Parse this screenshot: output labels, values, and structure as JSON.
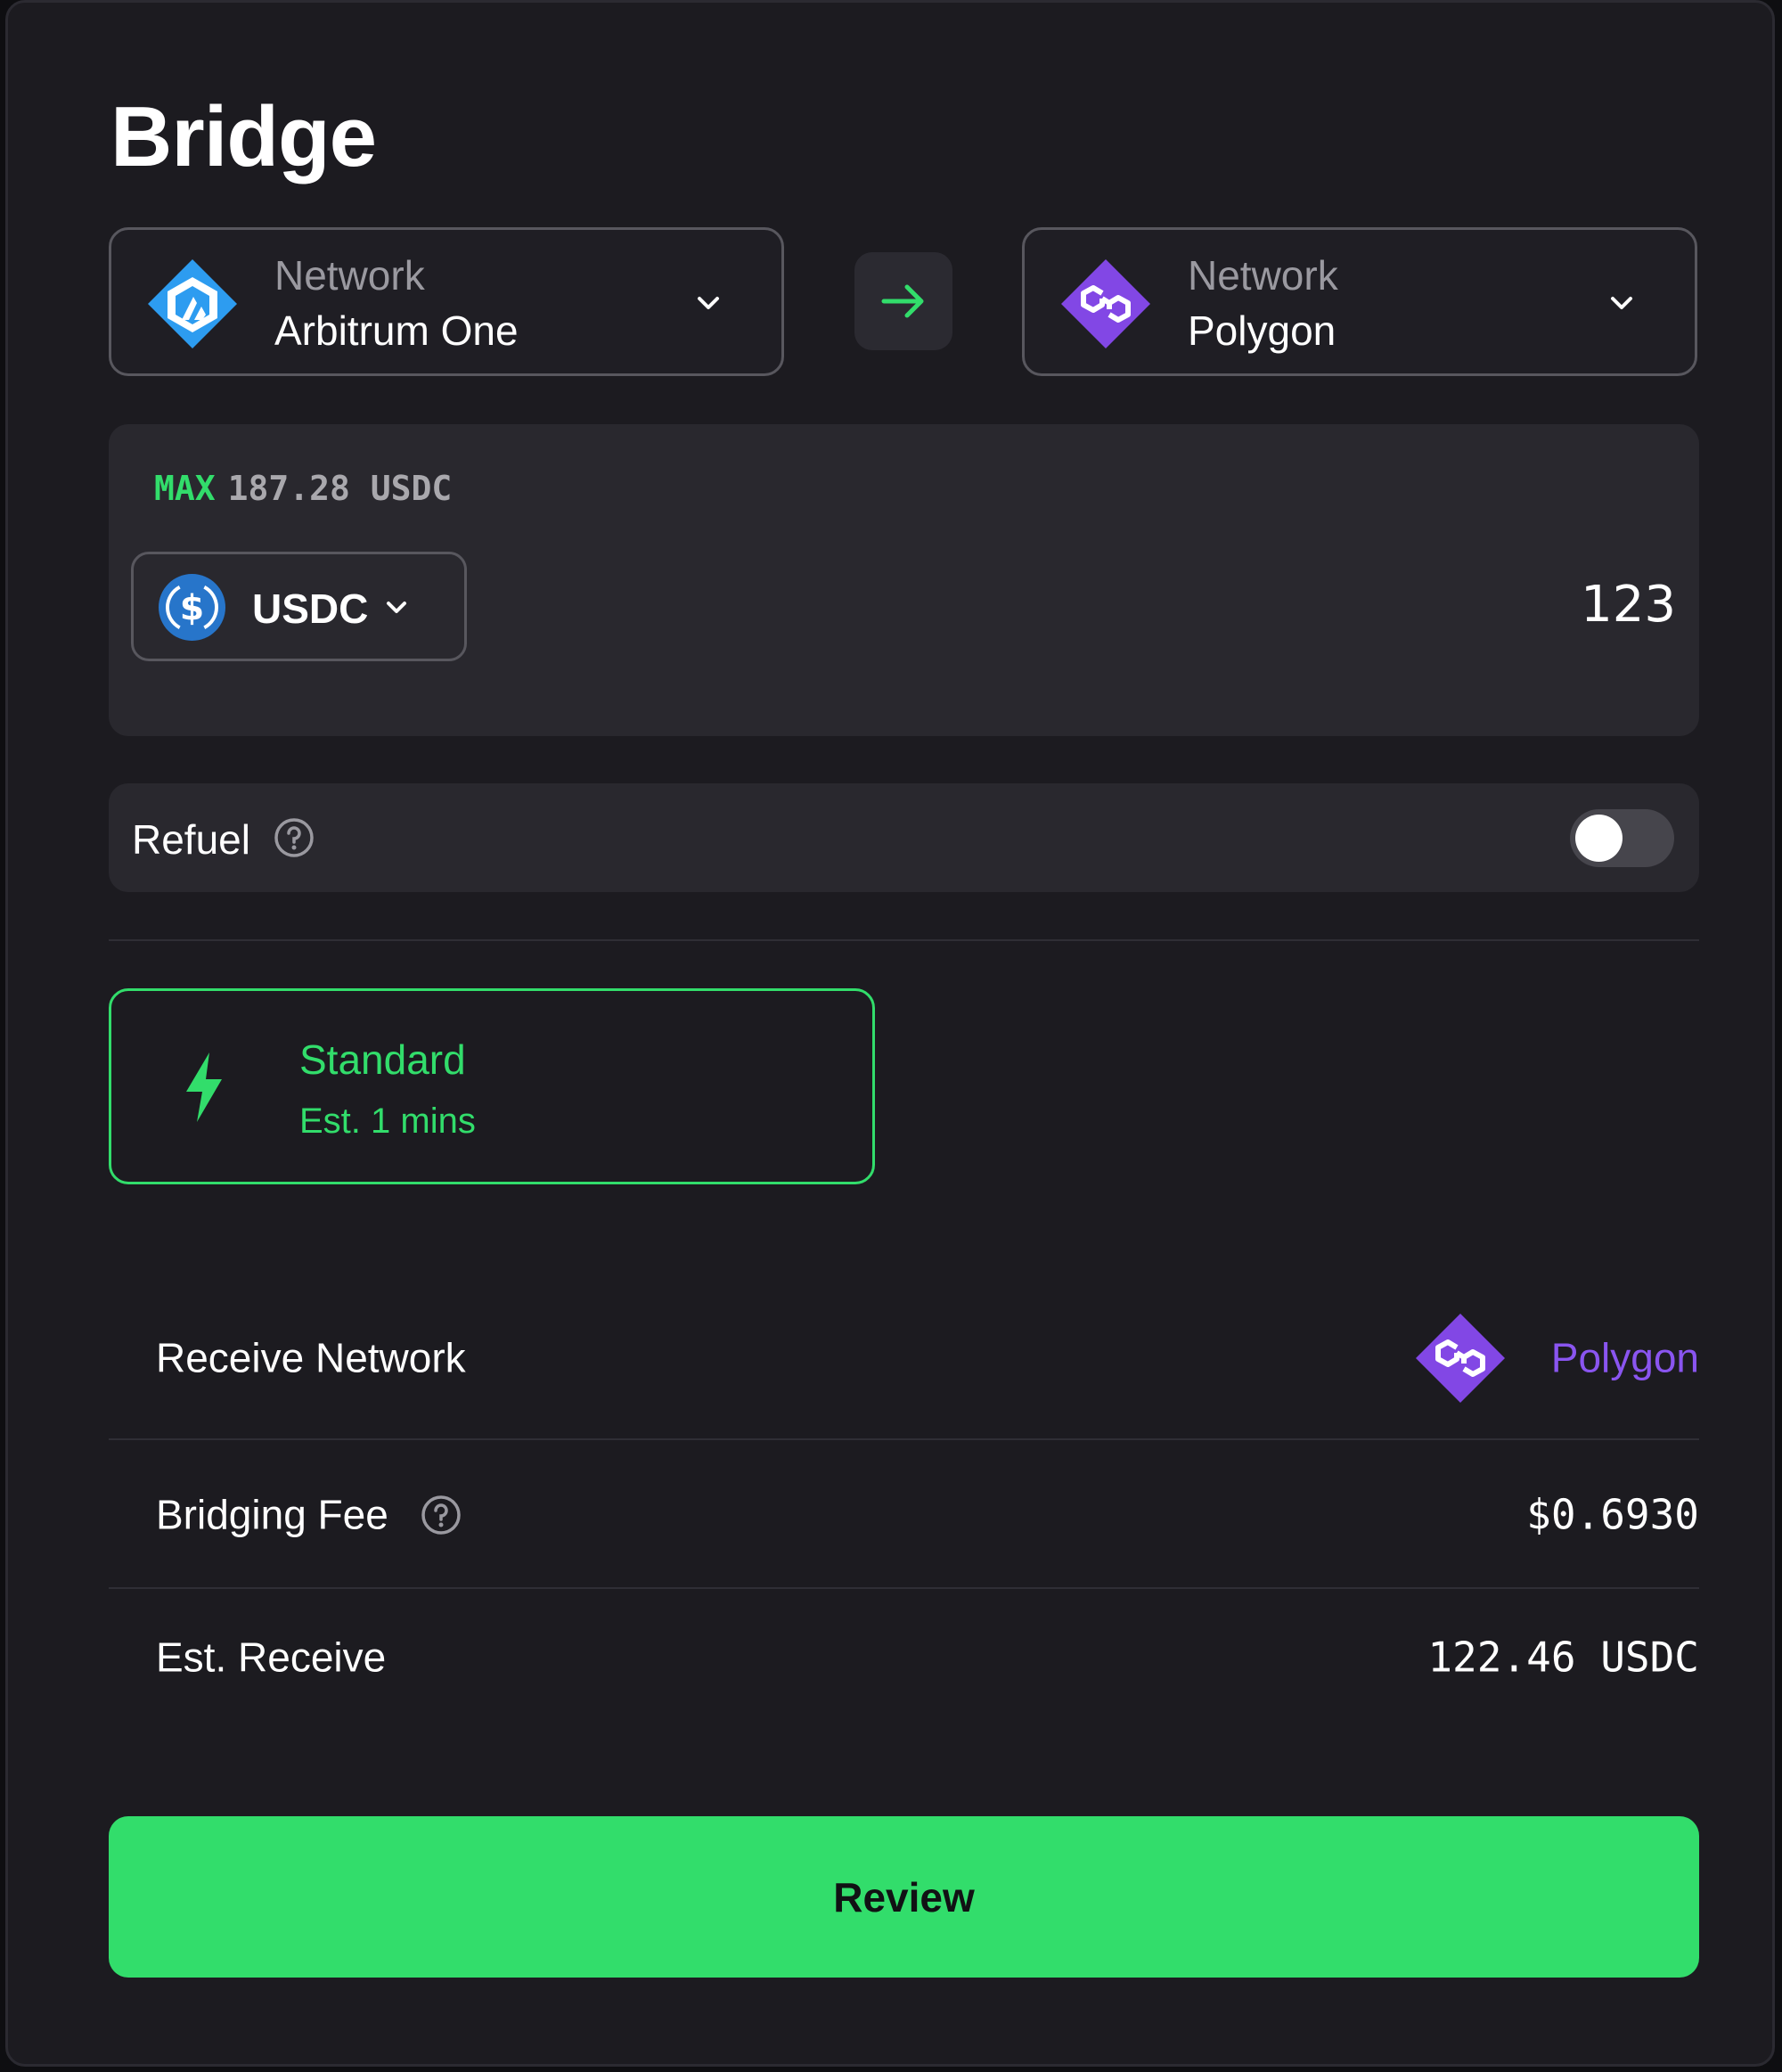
{
  "page": {
    "title": "Bridge"
  },
  "from_network": {
    "caption": "Network",
    "value": "Arbitrum One",
    "icon": "arbitrum-logo",
    "color": "#2d9cf0"
  },
  "to_network": {
    "caption": "Network",
    "value": "Polygon",
    "icon": "polygon-logo",
    "color": "#8247e5"
  },
  "swap": {
    "icon": "arrow-right-icon",
    "color": "#32dd6b"
  },
  "amount": {
    "max_label": "MAX",
    "balance": "187.28 USDC",
    "token": "USDC",
    "token_icon": "usdc-logo",
    "value": "123"
  },
  "refuel": {
    "label": "Refuel",
    "enabled": false
  },
  "route": {
    "name": "Standard",
    "eta": "Est. 1 mins",
    "icon": "lightning-bolt-icon",
    "selected": true
  },
  "summary": {
    "receive_network_label": "Receive Network",
    "receive_network_value": "Polygon",
    "fee_label": "Bridging Fee",
    "fee_value": "$0.6930",
    "receive_label": "Est. Receive",
    "receive_value": "122.46 USDC"
  },
  "actions": {
    "review_label": "Review"
  },
  "colors": {
    "accent": "#32dd6b",
    "polygon": "#8247e5",
    "arbitrum": "#2d9cf0",
    "usdc": "#2775ca",
    "background": "#1c1b20",
    "card": "#29282e"
  }
}
